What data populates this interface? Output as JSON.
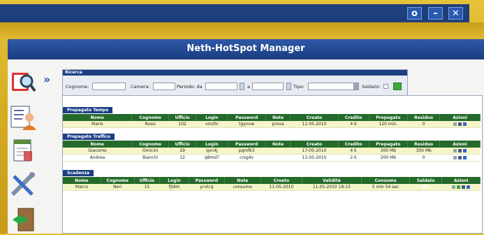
{
  "window": {
    "controls": [
      {
        "name": "window-menu-button",
        "glyph": "o"
      },
      {
        "name": "minimize-button",
        "glyph": "–"
      },
      {
        "name": "close-button",
        "glyph": "✕"
      }
    ]
  },
  "app": {
    "title": "Neth-HotSpot Manager"
  },
  "sidebar": {
    "items": [
      {
        "name": "search-icon"
      },
      {
        "name": "users-icon"
      },
      {
        "name": "reports-icon"
      },
      {
        "name": "settings-icon"
      },
      {
        "name": "exit-icon"
      }
    ],
    "expand_glyph": "»"
  },
  "search": {
    "header": "Ricerca",
    "cognome_label": "Cognome:",
    "camera_label": "Camera:",
    "periodo_label": "Periodo: da",
    "a_label": "a",
    "tipo_label": "Tipo:",
    "saldato_label": "Saldato:"
  },
  "sections": {
    "tempo": {
      "title": "Prepagato Tempo",
      "headers": [
        "Nome",
        "Cognome",
        "Ufficio",
        "Login",
        "Password",
        "Note",
        "Creato",
        "Credito",
        "Prepagato",
        "Residuo",
        "Azioni"
      ],
      "rows": [
        [
          "Mario",
          "Rossi",
          "102",
          "vmzhr",
          "tgynvw",
          "prova",
          "11-05-2010",
          "4 €",
          "120 min.",
          "0",
          ""
        ]
      ]
    },
    "traffico": {
      "title": "Prepagato Traffico",
      "headers": [
        "Nome",
        "Cognome",
        "Ufficio",
        "Login",
        "Password",
        "Note",
        "Creato",
        "Credito",
        "Prepagato",
        "Residuo",
        "Azioni"
      ],
      "rows": [
        [
          "Giacomo",
          "Omicini",
          "29",
          "qxn4j",
          "pqmfk3",
          "",
          "17-05-2010",
          "4 €",
          "300 Mb",
          "300 Mb",
          ""
        ],
        [
          "Andrea",
          "Bianchi",
          "12",
          "q8md7",
          "crsg4v",
          "",
          "11-05-2010",
          "2 €",
          "200 Mb",
          "0",
          ""
        ]
      ]
    },
    "scadenza": {
      "title": "Scadenza",
      "headers": [
        "Nome",
        "Cognome",
        "Ufficio",
        "Login",
        "Password",
        "Note",
        "Creato",
        "Validità",
        "Consumo",
        "Saldato",
        "Azioni"
      ],
      "rows": [
        [
          "Marco",
          "Neri",
          "15",
          "fjtdm",
          "yrvtcq",
          "consumo",
          "11-05-2010",
          "11-05-2010 18:15",
          "5 min 54 sec",
          "NO",
          ""
        ]
      ]
    }
  }
}
